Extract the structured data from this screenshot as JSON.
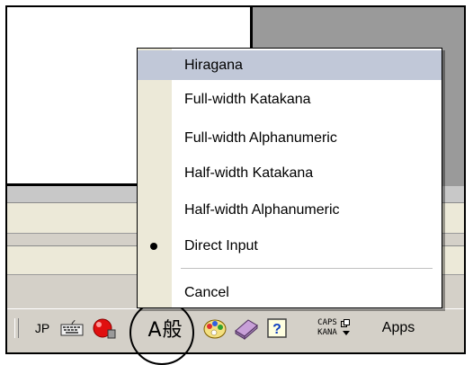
{
  "menu": {
    "items": [
      {
        "label": "Hiragana",
        "highlighted": true,
        "checked": false
      },
      {
        "label": "Full-width Katakana",
        "highlighted": false,
        "checked": false
      },
      {
        "label": "Full-width Alphanumeric",
        "highlighted": false,
        "checked": false
      },
      {
        "label": "Half-width Katakana",
        "highlighted": false,
        "checked": false
      },
      {
        "label": "Half-width Alphanumeric",
        "highlighted": false,
        "checked": false
      },
      {
        "label": "Direct Input",
        "highlighted": false,
        "checked": true
      }
    ],
    "cancel_label": "Cancel"
  },
  "language_bar": {
    "language": "JP",
    "input_mode_text": "A般",
    "caps_label": "CAPS",
    "kana_label": "KANA",
    "help_glyph": "?",
    "apps_label": "Apps",
    "icons": [
      "keyboard-icon",
      "ime-red-icon",
      "ime-pad-icon",
      "dictionary-tool-icon",
      "help-icon",
      "dropdown-arrow-icon"
    ]
  },
  "colors": {
    "highlight": "#c1c8d8",
    "menu_background": "#ffffff",
    "toolbar": "#d4d0c8"
  }
}
